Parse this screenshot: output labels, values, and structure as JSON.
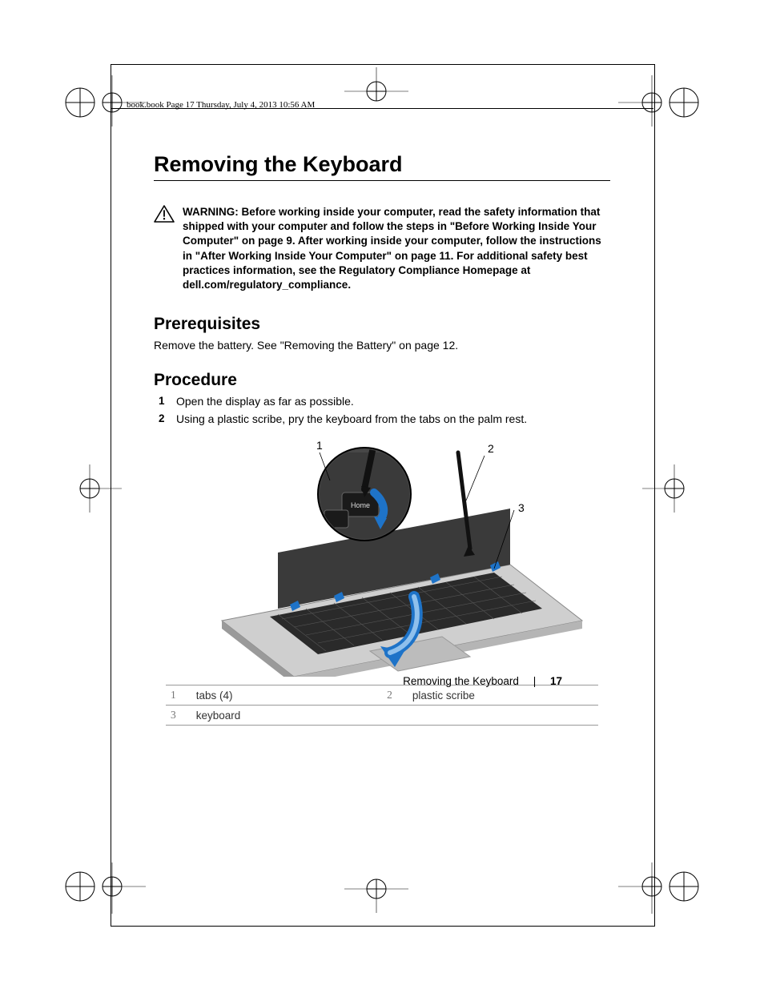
{
  "header_line": "book.book  Page 17  Thursday, July 4, 2013  10:56 AM",
  "title": "Removing the Keyboard",
  "warning_label": "WARNING:",
  "warning_text": "Before working inside your computer, read the safety information that shipped with your computer and follow the steps in \"Before Working Inside Your Computer\" on page 9. After working inside your computer, follow the instructions in \"After Working Inside Your Computer\" on page 11. For additional safety best practices information, see the Regulatory Compliance Homepage at dell.com/regulatory_compliance.",
  "sections": {
    "prereq_heading": "Prerequisites",
    "prereq_text": "Remove the battery. See \"Removing the Battery\" on page 12.",
    "proc_heading": "Procedure",
    "steps": [
      "Open the display as far as possible.",
      "Using a plastic scribe, pry the keyboard from the tabs on the palm rest."
    ]
  },
  "callouts": {
    "c1": "1",
    "c2": "2",
    "c3": "3"
  },
  "legend": {
    "r1n": "1",
    "r1l": "tabs (4)",
    "r2n": "2",
    "r2l": "plastic scribe",
    "r3n": "3",
    "r3l": "keyboard"
  },
  "footer": {
    "title": "Removing the Keyboard",
    "sep": "|",
    "page": "17"
  }
}
